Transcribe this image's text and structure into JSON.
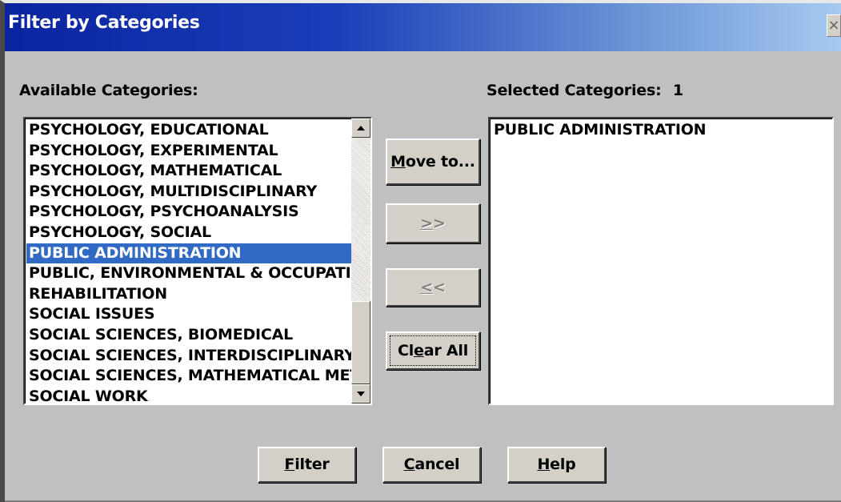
{
  "window": {
    "title": "Filter by Categories",
    "close_symbol": "×"
  },
  "available": {
    "label": "Available Categories:",
    "items": [
      "PSYCHOLOGY, EDUCATIONAL",
      "PSYCHOLOGY, EXPERIMENTAL",
      "PSYCHOLOGY, MATHEMATICAL",
      "PSYCHOLOGY, MULTIDISCIPLINARY",
      "PSYCHOLOGY, PSYCHOANALYSIS",
      "PSYCHOLOGY, SOCIAL",
      "PUBLIC ADMINISTRATION",
      "PUBLIC, ENVIRONMENTAL & OCCUPATIO",
      "REHABILITATION",
      "SOCIAL ISSUES",
      "SOCIAL SCIENCES, BIOMEDICAL",
      "SOCIAL SCIENCES, INTERDISCIPLINARY",
      "SOCIAL SCIENCES, MATHEMATICAL MET",
      "SOCIAL WORK"
    ],
    "selected_item": "PUBLIC ADMINISTRATION"
  },
  "selected": {
    "label": "Selected Categories:",
    "count": "1",
    "items": [
      "PUBLIC ADMINISTRATION"
    ]
  },
  "buttons": {
    "move_first": "M",
    "move_rest": "ove to...",
    "add_first": ">",
    "add_rest": ">",
    "remove_first": "<",
    "remove_rest": "<",
    "clear_first": "Cl",
    "clear_mid": "e",
    "clear_rest": "ar All",
    "filter_first": "F",
    "filter_rest": "ilter",
    "cancel_first": "C",
    "cancel_rest": "ancel",
    "help_first": "H",
    "help_rest": "elp"
  },
  "colors": {
    "title_bar_start": "#0a24a0",
    "title_bar_end": "#a6caf0",
    "selection": "#316ac5",
    "face": "#c0c0c0"
  }
}
